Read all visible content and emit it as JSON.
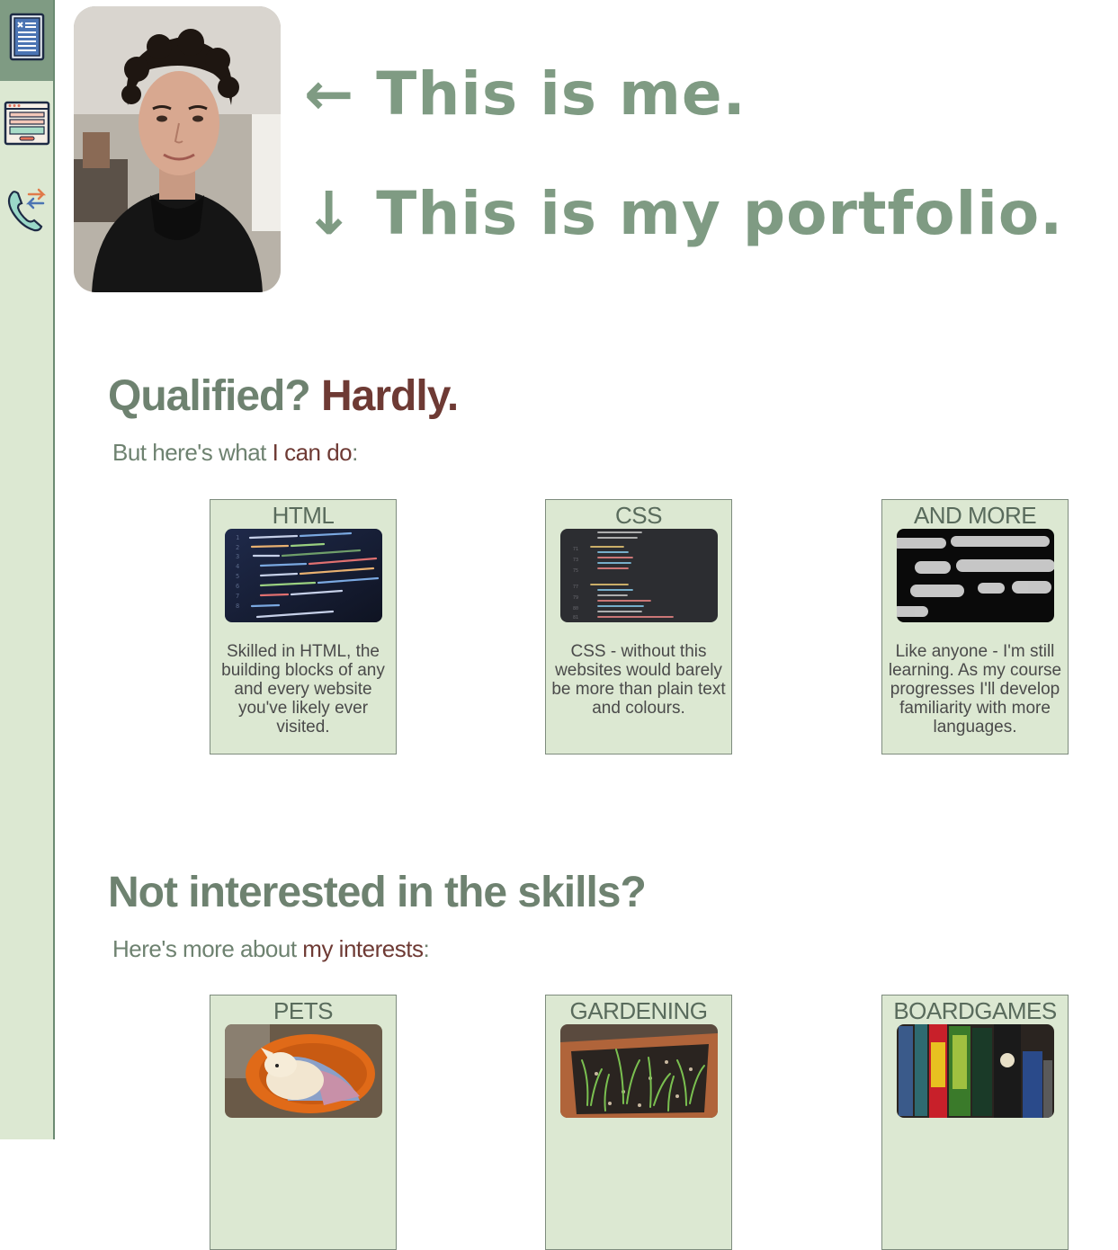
{
  "sidebar": {
    "items": [
      {
        "icon": "resume-document-icon",
        "active": true
      },
      {
        "icon": "webpage-layout-icon",
        "active": false
      },
      {
        "icon": "phone-contact-icon",
        "active": false
      }
    ],
    "colors": {
      "bg": "#dce8d2",
      "active": "#7f9b83"
    }
  },
  "header": {
    "line1_arrow": "←",
    "line1_text": "This is me.",
    "line2_arrow": "↓",
    "line2_text": "This is my portfolio."
  },
  "skills": {
    "heading_a": "Qualified? ",
    "heading_b": "Hardly.",
    "sub_a": "But here's what ",
    "sub_b": "I can do",
    "sub_c": ":",
    "cards": [
      {
        "title": "HTML",
        "text": "Skilled in HTML, the building blocks of any and every website you've likely ever visited."
      },
      {
        "title": "CSS",
        "text": "CSS - without this websites would barely be more than plain text and colours."
      },
      {
        "title": "AND MORE",
        "text": "Like anyone - I'm still learning. As my course progresses I'll develop familiarity with more languages."
      }
    ]
  },
  "interests": {
    "heading": "Not interested in the skills?",
    "sub_a": "Here's more about ",
    "sub_b": "my interests",
    "sub_c": ":",
    "cards": [
      {
        "title": "PETS"
      },
      {
        "title": "GARDENING"
      },
      {
        "title": "BOARDGAMES"
      }
    ]
  },
  "colors": {
    "sage": "#7f9b83",
    "maroon": "#6e3a34",
    "card_bg": "#dce8d2"
  }
}
